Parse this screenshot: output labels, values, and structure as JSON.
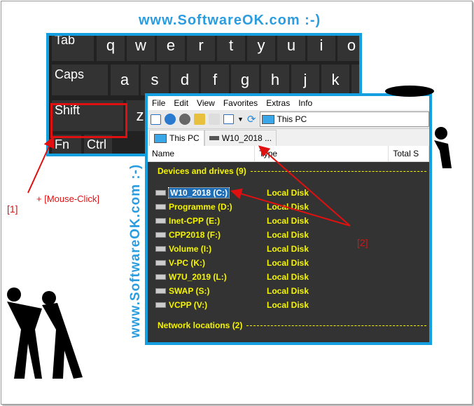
{
  "watermark_top": "www.SoftwareOK.com :-)",
  "watermark_side": "www.SoftwareOK.com :-)",
  "keyboard": {
    "row1": [
      "Tab",
      "q",
      "w",
      "e",
      "r",
      "t",
      "y",
      "u",
      "i",
      "o"
    ],
    "row2": [
      "Caps",
      "a",
      "s",
      "d",
      "f",
      "g",
      "h",
      "j",
      "k",
      "l"
    ],
    "row3": [
      "Shift",
      "z"
    ],
    "row4": [
      "Fn",
      "Ctrl"
    ]
  },
  "annotations": {
    "label1": "[1]",
    "mouse_click": "+ [Mouse-Click]",
    "label2": "[2]"
  },
  "explorer": {
    "menu": [
      "File",
      "Edit",
      "View",
      "Favorites",
      "Extras",
      "Info"
    ],
    "address": "This PC",
    "tabs": [
      "This PC",
      "W10_2018 ..."
    ],
    "columns": [
      "Name",
      "Type",
      "Total S"
    ],
    "group1": "Devices and drives (9)",
    "drives": [
      {
        "name": "W10_2018 (C:)",
        "type": "Local Disk"
      },
      {
        "name": "Programme (D:)",
        "type": "Local Disk"
      },
      {
        "name": "Inet-CPP (E:)",
        "type": "Local Disk"
      },
      {
        "name": "CPP2018 (F:)",
        "type": "Local Disk"
      },
      {
        "name": "Volume (I:)",
        "type": "Local Disk"
      },
      {
        "name": "V-PC (K:)",
        "type": "Local Disk"
      },
      {
        "name": "W7U_2019 (L:)",
        "type": "Local Disk"
      },
      {
        "name": "SWAP (S:)",
        "type": "Local Disk"
      },
      {
        "name": "VCPP (V:)",
        "type": "Local Disk"
      }
    ],
    "group2": "Network locations (2)"
  },
  "colors": {
    "accent": "#14a0e0",
    "highlight": "#e01010",
    "group_text": "#f5f500"
  }
}
